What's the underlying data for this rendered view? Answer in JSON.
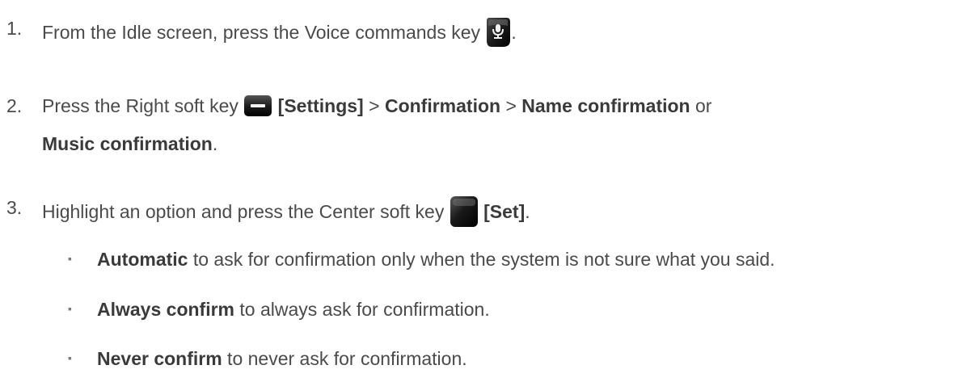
{
  "steps": [
    {
      "number": "1.",
      "parts": {
        "t1": "From the Idle screen, press the Voice commands key ",
        "t2": "."
      },
      "icon": "microphone-key-icon"
    },
    {
      "number": "2.",
      "parts": {
        "t1": "Press the Right soft key ",
        "b1": "[Settings]",
        "t2": " > ",
        "b2": "Confirmation",
        "t3": " > ",
        "b3": "Name confirmation",
        "t4": " or",
        "b4": "Music confirmation",
        "t5": "."
      },
      "icon": "right-soft-key-icon"
    },
    {
      "number": "3.",
      "parts": {
        "t1": "Highlight an option and press the Center soft key ",
        "b1": "[Set]",
        "t2": "."
      },
      "icon": "center-soft-key-icon"
    }
  ],
  "options": [
    {
      "marker": "▪",
      "term": "Automatic",
      "desc": " to ask for confirmation only when the system is not sure what you said."
    },
    {
      "marker": "▪",
      "term": "Always confirm",
      "desc": " to always ask for confirmation."
    },
    {
      "marker": "▪",
      "term": "Never confirm",
      "desc": " to never ask for confirmation."
    }
  ],
  "colors": {
    "text": "#4a4a4a",
    "bold": "#3a3a3a",
    "key_dark": "#1a1a1a"
  }
}
